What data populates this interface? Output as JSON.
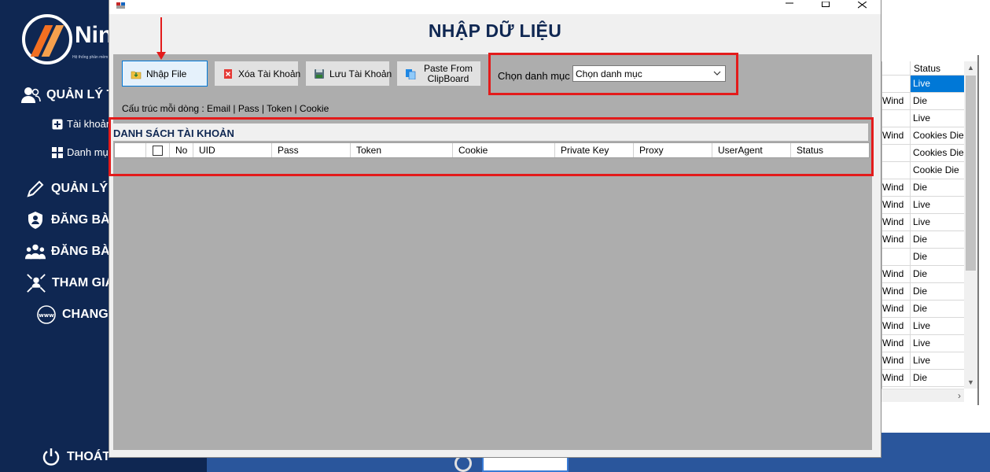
{
  "background_app": {
    "brand": "Nin",
    "tagline": "Hệ thống phần mềm",
    "menu": [
      {
        "label": "QUẢN LÝ T",
        "icon": "users-icon"
      },
      {
        "label": "Tài khoản",
        "icon": "plus-box-icon"
      },
      {
        "label": "Danh mục",
        "icon": "grid-icon"
      },
      {
        "label": "QUẢN LÝ B",
        "icon": "pencil-icon"
      },
      {
        "label": "ĐĂNG BÀI",
        "icon": "shield-user-icon"
      },
      {
        "label": "ĐĂNG BÀI",
        "icon": "group-icon"
      },
      {
        "label": "THAM GIA",
        "icon": "network-icon"
      },
      {
        "label": "CHANGE",
        "icon": "globe-www-icon"
      }
    ],
    "logout_label": "THOÁT",
    "status_header": "Status",
    "status_rows": [
      {
        "prefix": "",
        "status": "Live",
        "selected": true
      },
      {
        "prefix": "Wind",
        "status": "Die",
        "selected": false
      },
      {
        "prefix": "",
        "status": "Live",
        "selected": false
      },
      {
        "prefix": "Wind",
        "status": "Cookies Die",
        "selected": false
      },
      {
        "prefix": "",
        "status": "Cookies Die",
        "selected": false
      },
      {
        "prefix": "",
        "status": "Cookie Die",
        "selected": false
      },
      {
        "prefix": "Wind",
        "status": "Die",
        "selected": false
      },
      {
        "prefix": "Wind",
        "status": "Live",
        "selected": false
      },
      {
        "prefix": "Wind",
        "status": "Live",
        "selected": false
      },
      {
        "prefix": "Wind",
        "status": "Die",
        "selected": false
      },
      {
        "prefix": "",
        "status": "Die",
        "selected": false
      },
      {
        "prefix": "Wind",
        "status": "Die",
        "selected": false
      },
      {
        "prefix": "Wind",
        "status": "Die",
        "selected": false
      },
      {
        "prefix": "Wind",
        "status": "Die",
        "selected": false
      },
      {
        "prefix": "Wind",
        "status": "Live",
        "selected": false
      },
      {
        "prefix": "Wind",
        "status": "Live",
        "selected": false
      },
      {
        "prefix": "Wind",
        "status": "Live",
        "selected": false
      },
      {
        "prefix": "Wind",
        "status": "Die",
        "selected": false
      }
    ]
  },
  "modal": {
    "title": "NHẬP DỮ LIỆU",
    "toolbar": {
      "import_label": "Nhập File",
      "delete_label": "Xóa Tài Khoản",
      "save_label": "Lưu Tài Khoản",
      "paste_label_line1": "Paste From",
      "paste_label_line2": "ClipBoard"
    },
    "category": {
      "label": "Chọn danh mục",
      "selected_value": "Chọn danh mục"
    },
    "structure_hint": "Cấu trúc mỗi dòng : Email | Pass | Token | Cookie",
    "list_title": "DANH SÁCH TÀI KHOẢN",
    "columns": [
      "No",
      "UID",
      "Pass",
      "Token",
      "Cookie",
      "Private Key",
      "Proxy",
      "UserAgent",
      "Status"
    ]
  },
  "colors": {
    "sidebar_bg": "#0f2752",
    "title_text": "#0f2752",
    "annotation_red": "#e31b1b",
    "selection_blue": "#0078d7",
    "panel_gray": "#adadad"
  }
}
